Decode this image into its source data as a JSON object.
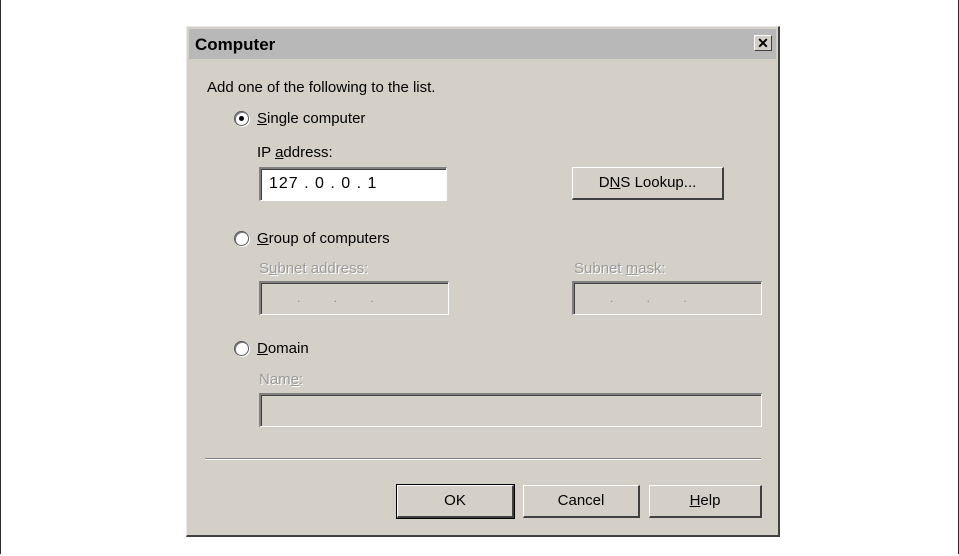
{
  "dialog": {
    "title": "Computer",
    "close_glyph": "✕",
    "instruction": "Add one of the following to the list."
  },
  "single": {
    "label_pre": "",
    "label_key": "S",
    "label_post": "ingle computer",
    "selected": true,
    "ip_label_pre": "IP ",
    "ip_label_key": "a",
    "ip_label_post": "ddress:",
    "ip_value": "127 . 0 . 0 . 1",
    "dns_pre": "D",
    "dns_key": "N",
    "dns_post": "S Lookup..."
  },
  "group": {
    "label_pre": "",
    "label_key": "G",
    "label_post": "roup of computers",
    "selected": false,
    "subnet_address_pre": "S",
    "subnet_address_key": "u",
    "subnet_address_post": "bnet address:",
    "subnet_mask_pre": "Subnet ",
    "subnet_mask_key": "m",
    "subnet_mask_post": "ask:",
    "empty_ip_dots": ".          .          ."
  },
  "domain": {
    "label_pre": "",
    "label_key": "D",
    "label_post": "omain",
    "selected": false,
    "name_pre": "Nam",
    "name_key": "e",
    "name_post": ":"
  },
  "buttons": {
    "ok": "OK",
    "cancel": "Cancel",
    "help_key": "H",
    "help_post": "elp"
  }
}
